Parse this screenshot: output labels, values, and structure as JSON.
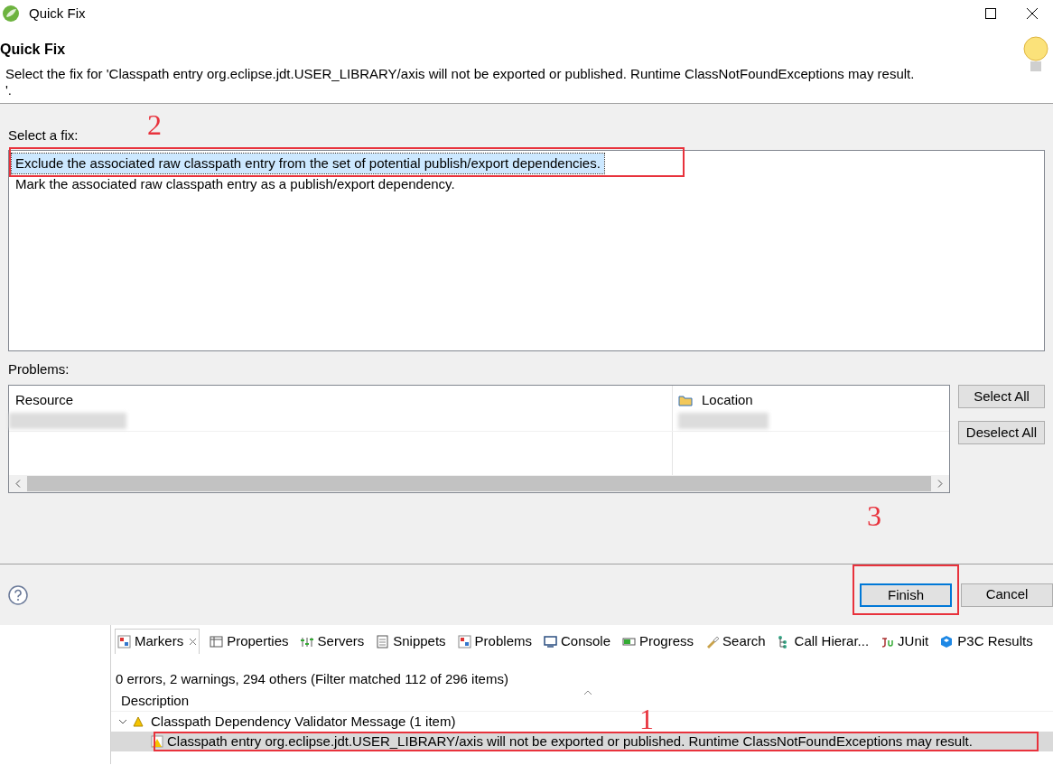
{
  "window": {
    "title": "Quick Fix"
  },
  "header": {
    "title": "Quick Fix",
    "message": "Select the fix for 'Classpath entry org.eclipse.jdt.USER_LIBRARY/axis will not be exported or published. Runtime ClassNotFoundExceptions may result.\n'."
  },
  "fixes": {
    "label": "Select a fix:",
    "items": [
      {
        "text": "Exclude the associated raw classpath entry from the set of potential publish/export dependencies.",
        "selected": true
      },
      {
        "text": "Mark the associated raw classpath entry as a publish/export dependency.",
        "selected": false
      }
    ]
  },
  "problems": {
    "label": "Problems:",
    "columns": [
      "Resource",
      "Location"
    ],
    "buttons": [
      "Select All",
      "Deselect All"
    ]
  },
  "footer": {
    "buttons": [
      {
        "label": "Finish",
        "default": true
      },
      {
        "label": "Cancel",
        "default": false
      }
    ]
  },
  "markers": {
    "tabs": [
      {
        "label": "Markers",
        "selected": true,
        "kind": "markers"
      },
      {
        "label": "Properties",
        "selected": false,
        "kind": "table"
      },
      {
        "label": "Servers",
        "selected": false,
        "kind": "servers"
      },
      {
        "label": "Snippets",
        "selected": false,
        "kind": "doc"
      },
      {
        "label": "Problems",
        "selected": false,
        "kind": "markers"
      },
      {
        "label": "Console",
        "selected": false,
        "kind": "monitor"
      },
      {
        "label": "Progress",
        "selected": false,
        "kind": "progress"
      },
      {
        "label": "Search",
        "selected": false,
        "kind": "torch"
      },
      {
        "label": "Call Hierar...",
        "selected": false,
        "kind": "tree"
      },
      {
        "label": "JUnit",
        "selected": false,
        "kind": "junit"
      },
      {
        "label": "P3C Results",
        "selected": false,
        "kind": "p3c"
      }
    ],
    "summary": "0 errors, 2 warnings, 294 others (Filter matched 112 of 296 items)",
    "column": "Description",
    "groups": [
      {
        "text": "Classpath Dependency Validator Message (1 item)",
        "expanded": true,
        "children": [
          {
            "text": "Classpath entry org.eclipse.jdt.USER_LIBRARY/axis will not be exported or published. Runtime ClassNotFoundExceptions may result.",
            "selected": true
          }
        ]
      }
    ]
  },
  "annotations": [
    "1",
    "2",
    "3"
  ]
}
